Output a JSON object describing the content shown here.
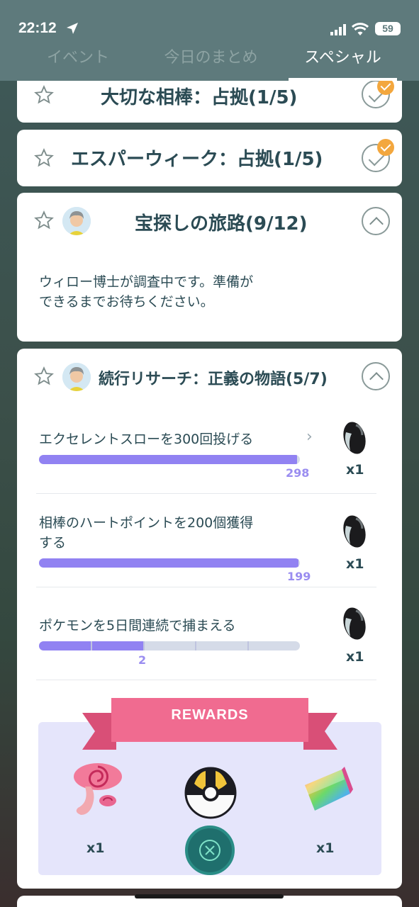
{
  "status_bar": {
    "time": "22:12",
    "battery": "59"
  },
  "tabs": [
    {
      "label": "イベント"
    },
    {
      "label": "今日のまとめ"
    },
    {
      "label": "スペシャル"
    }
  ],
  "cards": {
    "partner": {
      "title": "大切な相棒：占拠(1/5)"
    },
    "esper": {
      "title": "エスパーウィーク：占拠(1/5)"
    },
    "treasure": {
      "title": "宝探しの旅路(9/12)",
      "message_line1": "ウィロー博士が調査中です。準備が",
      "message_line2": "できるまでお待ちください。"
    },
    "research": {
      "title": "続行リサーチ：正義の物語(5/7)",
      "tasks": [
        {
          "text": "エクセレントスローを300回投げる",
          "progress": "298",
          "progress_fraction": 0.99,
          "reward_count": "x1"
        },
        {
          "text_line1": "相棒のハートポイントを200個獲得",
          "text_line2": "する",
          "progress": "199",
          "progress_fraction": 0.995,
          "reward_count": "x1"
        },
        {
          "text": "ポケモンを5日間連続で捕まえる",
          "progress": "2",
          "progress_fraction": 0.4,
          "reward_count": "x1"
        }
      ],
      "rewards_label": "REWARDS",
      "rewards": [
        {
          "item": "mushroom-incense-icon",
          "count": "x1"
        },
        {
          "item": "ultra-ball-icon",
          "count": ""
        },
        {
          "item": "rainbow-candy-icon",
          "count": "x1"
        }
      ]
    }
  },
  "colors": {
    "header": "#5e7a7c",
    "title_text": "#2b4b54",
    "progress_fill": "#9182f2",
    "badge": "#f3a73e",
    "ribbon": "#f06b90",
    "rewards_bg": "#e5e5fb"
  }
}
